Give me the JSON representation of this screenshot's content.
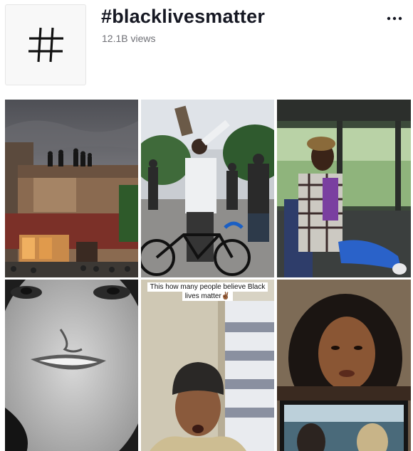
{
  "hashtag": {
    "icon": "hash-icon",
    "title": "#blacklivesmatter",
    "views": "12.1B views"
  },
  "header_actions": {
    "more_icon": "more-horizontal-icon"
  },
  "videos": [
    {
      "id": "rooftop-protest",
      "caption": ""
    },
    {
      "id": "street-march",
      "caption": ""
    },
    {
      "id": "bus-passenger",
      "caption": ""
    },
    {
      "id": "bw-closeup",
      "caption": ""
    },
    {
      "id": "beanie-selfie",
      "caption": "This how many people believe Black lives matter✌🏾"
    },
    {
      "id": "woman-portrait",
      "caption": ""
    }
  ]
}
